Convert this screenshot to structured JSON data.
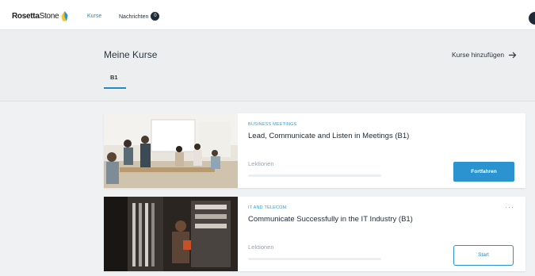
{
  "brand": {
    "name_bold": "Rosetta",
    "name_regular": "Stone",
    "accent": "#1f8ac3",
    "logo_color": "#f2c230"
  },
  "nav": {
    "kurse_label": "Kurse",
    "nachrichten_label": "Nachrichten",
    "nachrichten_count": "0"
  },
  "header": {
    "title": "Meine Kurse",
    "add_courses_label": "Kurse hinzufügen",
    "tabs": [
      {
        "label": "B1",
        "active": true
      }
    ]
  },
  "courses": [
    {
      "category": "BUSINESS MEETINGS",
      "title": "Lead, Communicate and Listen in Meetings (B1)",
      "lessons_label": "Lektionen",
      "progress": 0,
      "button_label": "Fortfahren",
      "image_icon": "meeting-photo"
    },
    {
      "category": "IT AND TELECOM",
      "title": "Communicate Successfully in the IT Industry (B1)",
      "lessons_label": "Lektionen",
      "progress": 0,
      "button_label": "Start",
      "more_label": "···",
      "image_icon": "server-room-photo"
    }
  ]
}
